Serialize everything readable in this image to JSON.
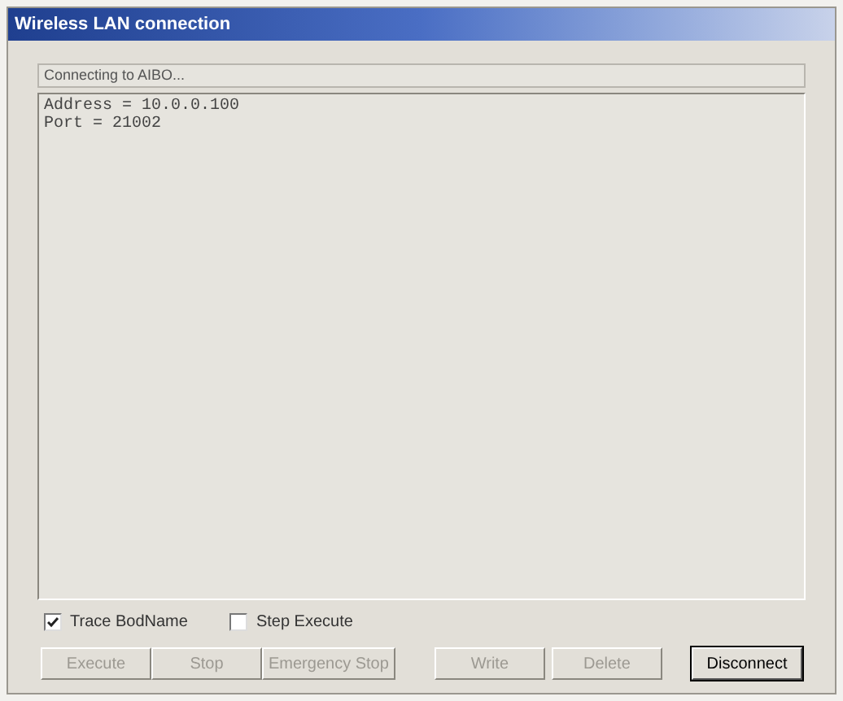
{
  "window": {
    "title": "Wireless LAN connection"
  },
  "status": "Connecting to AIBO...",
  "log": [
    "Address = 10.0.0.100",
    "Port = 21002"
  ],
  "checkboxes": [
    {
      "label": "Trace BodName",
      "checked": true
    },
    {
      "label": "Step Execute",
      "checked": false
    }
  ],
  "buttons": [
    {
      "label": "Execute",
      "disabled": true,
      "default": false
    },
    {
      "label": "Stop",
      "disabled": true,
      "default": false
    },
    {
      "label": "Emergency Stop",
      "disabled": true,
      "default": false
    },
    {
      "label": "Write",
      "disabled": true,
      "default": false
    },
    {
      "label": "Delete",
      "disabled": true,
      "default": false
    },
    {
      "label": "Disconnect",
      "disabled": false,
      "default": true
    }
  ]
}
